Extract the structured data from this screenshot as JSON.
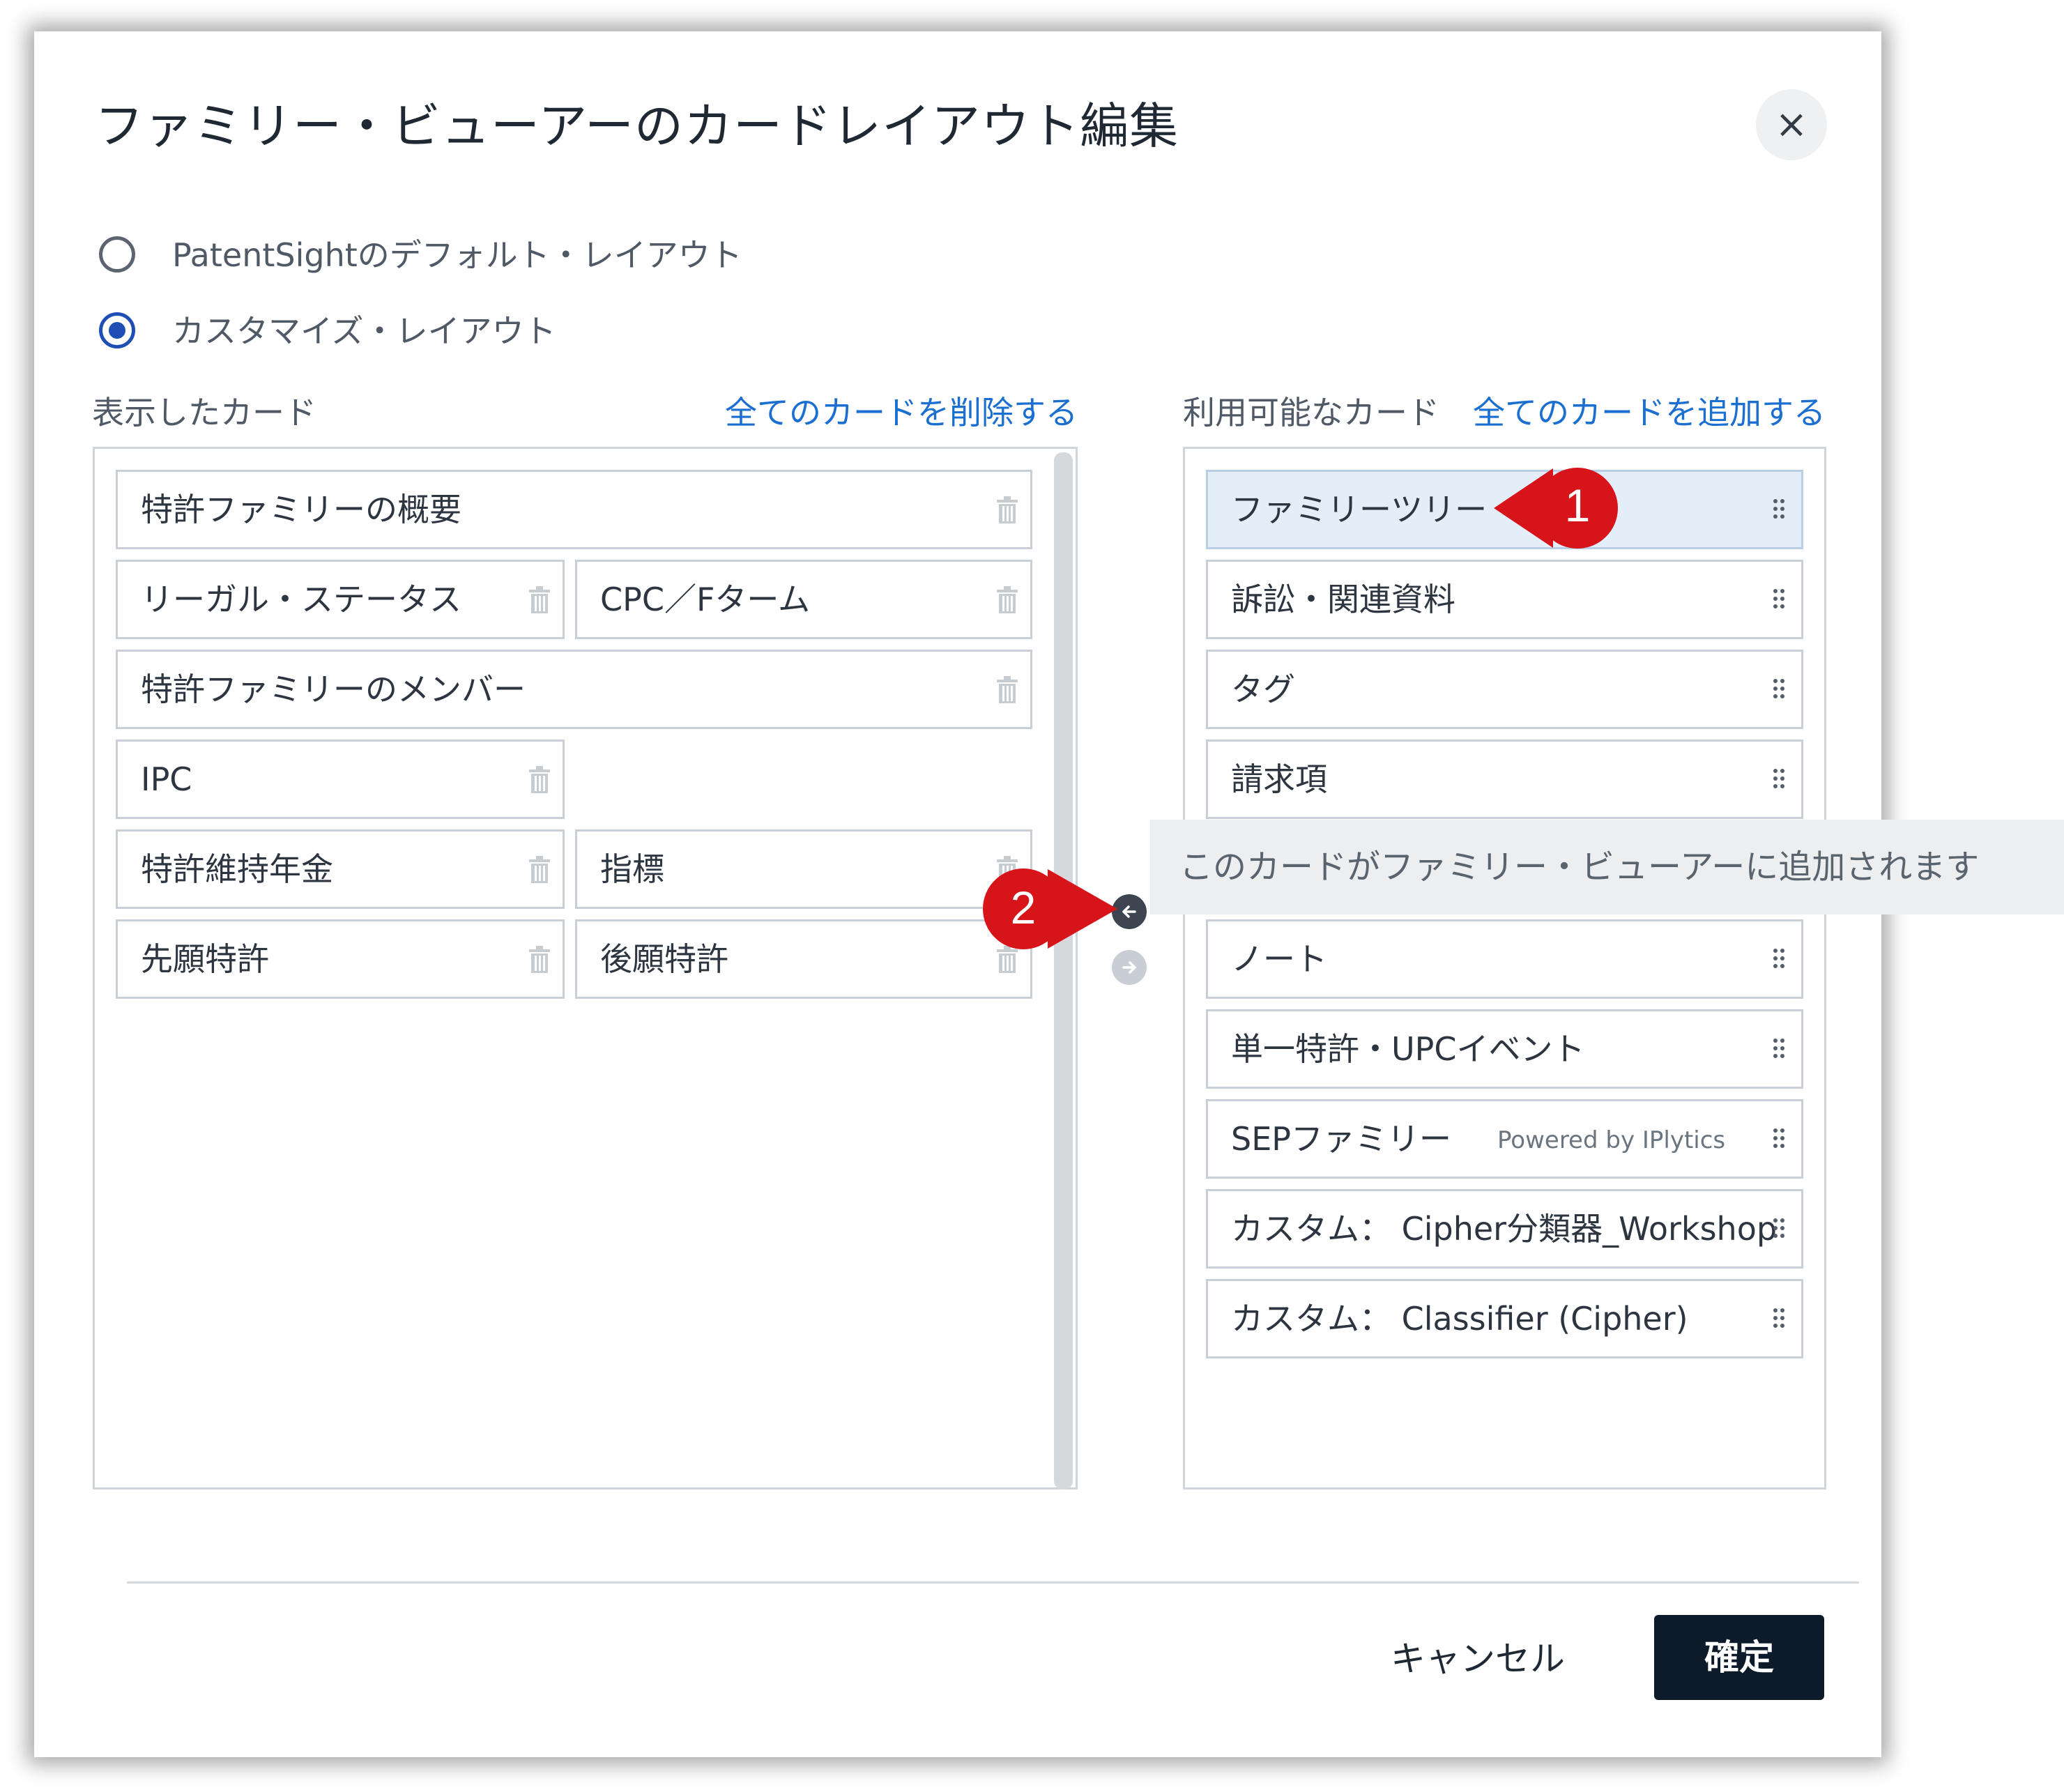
{
  "dialog": {
    "title": "ファミリー・ビューアーのカードレイアウト編集",
    "close_icon": "×"
  },
  "layout_options": [
    {
      "label": "PatentSightのデフォルト・レイアウト",
      "selected": false
    },
    {
      "label": "カスタマイズ・レイアウト",
      "selected": true
    }
  ],
  "displayed_cards": {
    "header": "表示したカード",
    "remove_all_link": "全てのカードを削除する",
    "rows": [
      [
        "特許ファミリーの概要"
      ],
      [
        "リーガル・ステータス",
        "CPC／Fターム"
      ],
      [
        "特許ファミリーのメンバー"
      ],
      [
        "IPC"
      ],
      [
        "特許維持年金",
        "指標"
      ],
      [
        "先願特許",
        "後願特許"
      ]
    ]
  },
  "available_cards": {
    "header": "利用可能なカード",
    "add_all_link": "全てのカードを追加する",
    "items": [
      {
        "label": "ファミリーツリー",
        "highlighted": true
      },
      {
        "label": "訴訟・関連資料"
      },
      {
        "label": "タグ"
      },
      {
        "label": "請求項"
      },
      {
        "label": "ノート"
      },
      {
        "label": "単一特許・UPCイベント"
      },
      {
        "label": "SEPファミリー",
        "note": "Powered by IPlytics"
      },
      {
        "label": "カスタム： Cipher分類器_Workshop"
      },
      {
        "label": "カスタム： Classifier (Cipher)"
      }
    ]
  },
  "tooltip": {
    "text": "このカードがファミリー・ビューアーに追加されます"
  },
  "transfer_buttons": {
    "add_icon": "arrow-left-icon",
    "remove_icon": "arrow-right-icon"
  },
  "footer": {
    "cancel_label": "キャンセル",
    "confirm_label": "確定"
  },
  "callouts": [
    "1",
    "2"
  ],
  "colors": {
    "accent_link": "#1b6fd1",
    "callout_red": "#d7141a",
    "highlight_bg": "#e3eef9",
    "confirm_bg": "#0c1a2a"
  }
}
